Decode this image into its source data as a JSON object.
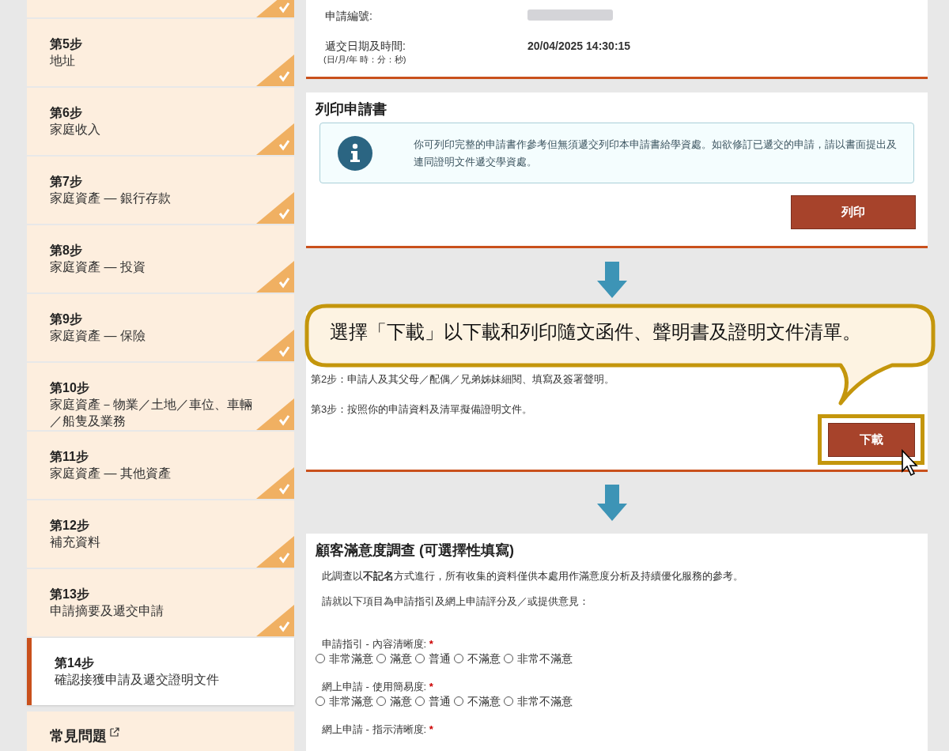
{
  "sidebar": {
    "steps": [
      {
        "step": "第5步",
        "title": "地址",
        "done": true,
        "selected": false
      },
      {
        "step": "第6步",
        "title": "家庭收入",
        "done": true,
        "selected": false
      },
      {
        "step": "第7步",
        "title": "家庭資產 — 銀行存款",
        "done": true,
        "selected": false
      },
      {
        "step": "第8步",
        "title": "家庭資產 — 投資",
        "done": true,
        "selected": false
      },
      {
        "step": "第9步",
        "title": "家庭資產 — 保險",
        "done": true,
        "selected": false
      },
      {
        "step": "第10步",
        "title": "家庭資產－物業／土地／車位、車輛／船隻及業務",
        "done": true,
        "selected": false
      },
      {
        "step": "第11步",
        "title": "家庭資產 — 其他資產",
        "done": true,
        "selected": false
      },
      {
        "step": "第12步",
        "title": "補充資料",
        "done": true,
        "selected": false
      },
      {
        "step": "第13步",
        "title": "申請摘要及遞交申請",
        "done": true,
        "selected": false
      },
      {
        "step": "第14步",
        "title": "確認接獲申請及遞交證明文件",
        "done": false,
        "selected": true
      }
    ],
    "faq": "常見問題"
  },
  "submission": {
    "fields": [
      {
        "label": "申請編號:"
      },
      {
        "label": "遞交日期及時間:",
        "hint": "(日/月/年 時：分：秒)",
        "date": "20/04/2025",
        "time": "14:30:15"
      }
    ]
  },
  "print_section": {
    "title": "列印申請書",
    "info": "你可列印完整的申請書作參考但無須遞交列印本申請書給學資處。如欲修訂已遞交的申請，請以書面提出及連同證明文件遞交學資處。",
    "button": "列印"
  },
  "download_section": {
    "steps": [
      "第2步：申請人及其父母／配偶／兄弟姊妹細閱、填寫及簽署聲明。",
      "第3步：按照你的申請資料及清單擬備證明文件。"
    ],
    "button": "下載"
  },
  "callout": "選擇「下載」以下載和列印隨文函件、聲明書及證明文件清單。",
  "survey": {
    "title": "顧客滿意度調查 (可選擇性填寫)",
    "intro": "此調查以**不記名**方式進行，所有收集的資料僅供本處用作滿意度分析及持續優化服務的參考。",
    "prompt": "請就以下項目為申請指引及網上申請評分及／或提供意見：",
    "questions": [
      {
        "label": "申請指引 - 內容清晰度:",
        "required_mark": "*",
        "options": [
          {
            "label": "非常滿意",
            "selected": false
          },
          {
            "label": "滿意",
            "selected": false
          },
          {
            "label": "普通",
            "selected": false
          },
          {
            "label": "不滿意",
            "selected": false
          },
          {
            "label": "非常不滿意",
            "selected": false
          }
        ]
      },
      {
        "label": "網上申請 - 使用簡易度:",
        "required_mark": "*",
        "options": [
          {
            "label": "非常滿意",
            "selected": false
          },
          {
            "label": "滿意",
            "selected": false
          },
          {
            "label": "普通",
            "selected": false
          },
          {
            "label": "不滿意",
            "selected": false
          },
          {
            "label": "非常不滿意",
            "selected": false
          }
        ]
      },
      {
        "label": "網上申請 - 指示清晰度:",
        "required_mark": "*"
      }
    ]
  }
}
